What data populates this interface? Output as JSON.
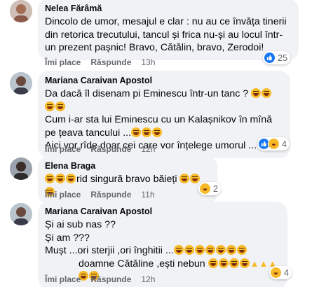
{
  "comments": [
    {
      "author": "Nelea Fărâmă",
      "text": "Dincolo de umor, mesajul e clar : nu au ce învăța tinerii din retorica trecutului, tancul și frica nu-și au locul într-un prezent pașnic! Bravo, Cătălin, bravo, Zerodoi!",
      "like_label": "Îmi place",
      "reply_label": "Răspunde",
      "time": "13h",
      "reaction_count": "25",
      "reaction_types": [
        "like-icon"
      ]
    },
    {
      "author": "Mariana Caraivan Apostol",
      "lines": [
        "Da dacă îl disenam pi Eminescu într-un tanc ?",
        "Cum i-ar sta lui Eminescu cu un Kalașnikov în mînă pe țeava tancului ...",
        "Aici vor rîde doar cei care vor înțelege umorul ..."
      ],
      "like_label": "Îmi place",
      "reply_label": "Răspunde",
      "time": "12h",
      "reaction_count": "4",
      "reaction_types": [
        "like-icon",
        "haha-icon"
      ]
    },
    {
      "author": "Elena Braga",
      "text": "rid singură bravo băieți",
      "like_label": "Îmi place",
      "reply_label": "Răspunde",
      "time": "11h",
      "reaction_count": "2",
      "reaction_types": [
        "haha-icon"
      ]
    },
    {
      "author": "Mariana Caraivan Apostol",
      "lines": [
        "Și ai sub nas ??",
        "Și am ???",
        "Mușt ...ori sterjii ,ori înghitii ...",
        "doamne Cătăline ,ești nebun"
      ],
      "like_label": "Îmi place",
      "reply_label": "Răspunde",
      "time": "12h",
      "reaction_count": "4",
      "reaction_types": [
        "haha-icon"
      ]
    }
  ],
  "colors": {
    "bubble": "#f0f2f5",
    "meta": "#65676b",
    "like": "#1877f2",
    "haha": "#f7b928"
  }
}
